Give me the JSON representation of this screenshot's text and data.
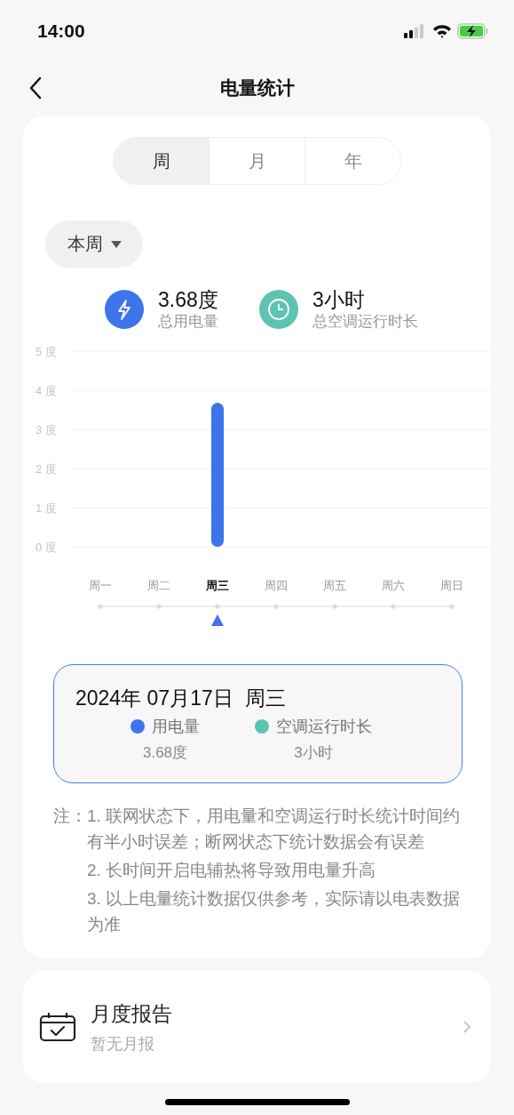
{
  "status_bar": {
    "time": "14:00"
  },
  "nav": {
    "title": "电量统计"
  },
  "period_tabs": [
    {
      "label": "周",
      "selected": true
    },
    {
      "label": "月",
      "selected": false
    },
    {
      "label": "年",
      "selected": false
    }
  ],
  "range_dropdown": {
    "label": "本周"
  },
  "summary": [
    {
      "kind": "energy",
      "value": "3.68度",
      "label": "总用电量",
      "color": "#3d74eb"
    },
    {
      "kind": "duration",
      "value": "3小时",
      "label": "总空调运行时长",
      "color": "#5cc4b1"
    }
  ],
  "chart": {
    "chart_data": {
      "type": "bar",
      "categories": [
        "周一",
        "周二",
        "周三",
        "周四",
        "周五",
        "周六",
        "周日"
      ],
      "grid": true,
      "series": [
        {
          "color": "#3d74eb",
          "values": [
            0,
            0,
            3.68,
            null,
            null,
            null,
            null
          ]
        }
      ],
      "ylim": [
        0,
        5
      ],
      "yticks": [
        {
          "value": 0,
          "label": "0 度"
        },
        {
          "value": 1,
          "label": "1 度"
        },
        {
          "value": 2,
          "label": "2 度"
        },
        {
          "value": 3,
          "label": "3 度"
        },
        {
          "value": 4,
          "label": "4 度"
        },
        {
          "value": 5,
          "label": "5 度"
        }
      ]
    },
    "day_markers": [
      {
        "selected": false
      },
      {
        "selected": false
      },
      {
        "selected": true
      },
      {
        "selected": false
      },
      {
        "selected": false
      },
      {
        "selected": false
      },
      {
        "selected": false
      }
    ]
  },
  "detail": {
    "date": "2024年 07月17日  周三",
    "items": [
      {
        "label": "用电量",
        "value": "3.68度",
        "color": "#3d74eb"
      },
      {
        "label": "空调运行时长",
        "value": "3小时",
        "color": "#5cc4b1"
      }
    ]
  },
  "notes": {
    "prefix": "注：",
    "items": [
      "1. 联网状态下，用电量和空调运行时长统计时间约有半小时误差；断网状态下统计数据会有误差",
      "2. 长时间开启电辅热将导致用电量升高",
      "3. 以上电量统计数据仅供参考，实际请以电表数据为准"
    ]
  },
  "report": {
    "title": "月度报告",
    "subtitle": "暂无月报"
  }
}
